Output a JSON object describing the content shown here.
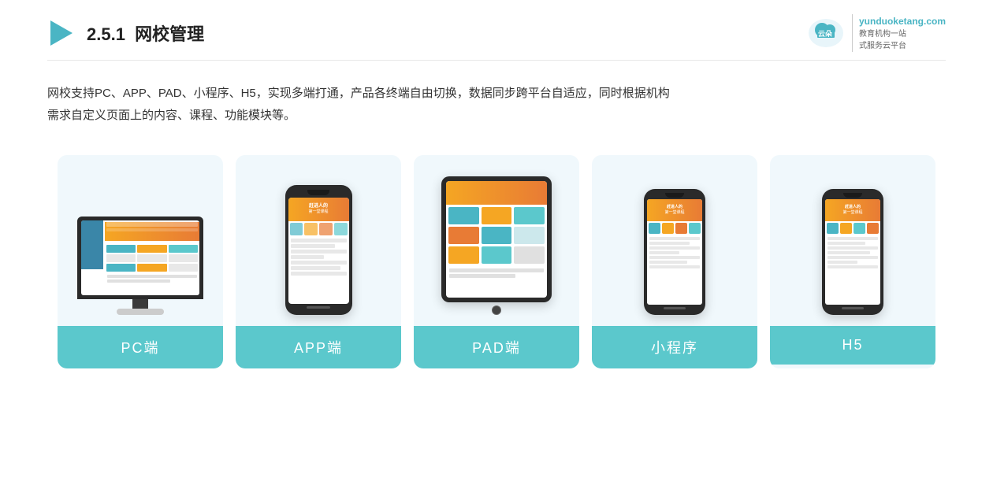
{
  "header": {
    "section_number": "2.5.1",
    "title_plain": "网校管理",
    "logo_url_text": "yunduoketang.com",
    "logo_tagline1": "教育机构一站",
    "logo_tagline2": "式服务云平台"
  },
  "description": {
    "line1": "网校支持PC、APP、PAD、小程序、H5，实现多端打通，产品各终端自由切换，数据同步跨平台自适应，同时根据机构",
    "line2": "需求自定义页面上的内容、课程、功能模块等。"
  },
  "cards": [
    {
      "id": "pc",
      "label": "PC端",
      "type": "pc"
    },
    {
      "id": "app",
      "label": "APP端",
      "type": "phone"
    },
    {
      "id": "pad",
      "label": "PAD端",
      "type": "tablet"
    },
    {
      "id": "mini",
      "label": "小程序",
      "type": "phone-sm"
    },
    {
      "id": "h5",
      "label": "H5",
      "type": "phone-sm"
    }
  ],
  "colors": {
    "teal": "#5bc8cc",
    "teal_light": "#e8f7f8",
    "card_bg": "#eef7fa",
    "orange": "#f5a623",
    "dark": "#2a2a2a"
  }
}
